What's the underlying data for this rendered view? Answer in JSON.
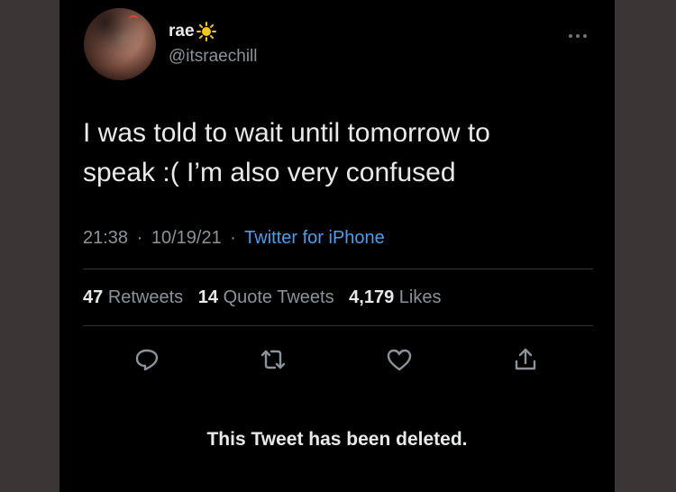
{
  "tweet": {
    "display_name": "rae",
    "handle": "@itsraechill",
    "text_line1": "I was told to wait until tomorrow to",
    "text_line2": "speak :( I’m also very confused",
    "time": "21:38",
    "date": "10/19/21",
    "separator": "·",
    "source": "Twitter for iPhone",
    "stats": {
      "retweets_count": "47",
      "retweets_label": "Retweets",
      "quotes_count": "14",
      "quotes_label": "Quote Tweets",
      "likes_count": "4,179",
      "likes_label": "Likes"
    },
    "deleted_notice": "This Tweet has been deleted."
  },
  "icons": {
    "name_emoji": "sun-icon",
    "menu": "more-icon",
    "reply": "reply-icon",
    "retweet": "retweet-icon",
    "like": "heart-icon",
    "share": "share-icon"
  },
  "colors": {
    "background": "#000000",
    "text": "#e7e9ea",
    "muted": "#8b9299",
    "link": "#4c9ded",
    "sun": "#f5c518"
  }
}
